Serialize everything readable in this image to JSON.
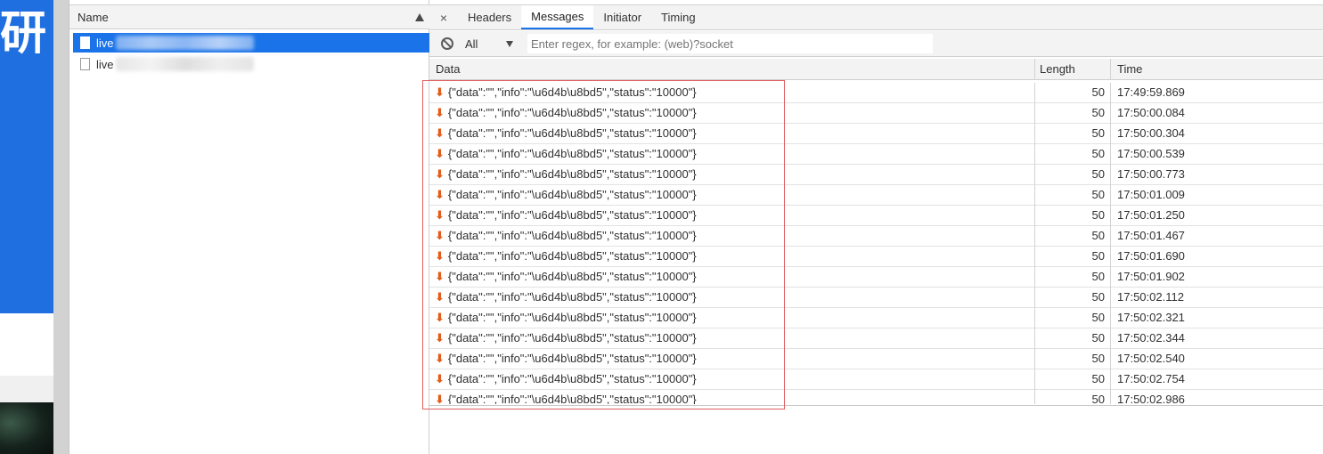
{
  "page": {
    "glyph": "研"
  },
  "name_pane": {
    "header": "Name",
    "items": [
      {
        "label": "live",
        "selected": true
      },
      {
        "label": "live",
        "selected": false
      }
    ]
  },
  "details": {
    "close_icon": "×",
    "tabs": [
      "Headers",
      "Messages",
      "Initiator",
      "Timing"
    ],
    "active_tab": "Messages",
    "filter": {
      "select_value": "All",
      "placeholder": "Enter regex, for example: (web)?socket",
      "value": ""
    },
    "columns": {
      "data": "Data",
      "length": "Length",
      "time": "Time"
    },
    "arrow_glyph": "⬇",
    "messages": [
      {
        "data": "{\"data\":\"\",\"info\":\"\\u6d4b\\u8bd5\",\"status\":\"10000\"}",
        "length": "50",
        "time": "17:49:59.869"
      },
      {
        "data": "{\"data\":\"\",\"info\":\"\\u6d4b\\u8bd5\",\"status\":\"10000\"}",
        "length": "50",
        "time": "17:50:00.084"
      },
      {
        "data": "{\"data\":\"\",\"info\":\"\\u6d4b\\u8bd5\",\"status\":\"10000\"}",
        "length": "50",
        "time": "17:50:00.304"
      },
      {
        "data": "{\"data\":\"\",\"info\":\"\\u6d4b\\u8bd5\",\"status\":\"10000\"}",
        "length": "50",
        "time": "17:50:00.539"
      },
      {
        "data": "{\"data\":\"\",\"info\":\"\\u6d4b\\u8bd5\",\"status\":\"10000\"}",
        "length": "50",
        "time": "17:50:00.773"
      },
      {
        "data": "{\"data\":\"\",\"info\":\"\\u6d4b\\u8bd5\",\"status\":\"10000\"}",
        "length": "50",
        "time": "17:50:01.009"
      },
      {
        "data": "{\"data\":\"\",\"info\":\"\\u6d4b\\u8bd5\",\"status\":\"10000\"}",
        "length": "50",
        "time": "17:50:01.250"
      },
      {
        "data": "{\"data\":\"\",\"info\":\"\\u6d4b\\u8bd5\",\"status\":\"10000\"}",
        "length": "50",
        "time": "17:50:01.467"
      },
      {
        "data": "{\"data\":\"\",\"info\":\"\\u6d4b\\u8bd5\",\"status\":\"10000\"}",
        "length": "50",
        "time": "17:50:01.690"
      },
      {
        "data": "{\"data\":\"\",\"info\":\"\\u6d4b\\u8bd5\",\"status\":\"10000\"}",
        "length": "50",
        "time": "17:50:01.902"
      },
      {
        "data": "{\"data\":\"\",\"info\":\"\\u6d4b\\u8bd5\",\"status\":\"10000\"}",
        "length": "50",
        "time": "17:50:02.112"
      },
      {
        "data": "{\"data\":\"\",\"info\":\"\\u6d4b\\u8bd5\",\"status\":\"10000\"}",
        "length": "50",
        "time": "17:50:02.321"
      },
      {
        "data": "{\"data\":\"\",\"info\":\"\\u6d4b\\u8bd5\",\"status\":\"10000\"}",
        "length": "50",
        "time": "17:50:02.344"
      },
      {
        "data": "{\"data\":\"\",\"info\":\"\\u6d4b\\u8bd5\",\"status\":\"10000\"}",
        "length": "50",
        "time": "17:50:02.540"
      },
      {
        "data": "{\"data\":\"\",\"info\":\"\\u6d4b\\u8bd5\",\"status\":\"10000\"}",
        "length": "50",
        "time": "17:50:02.754"
      },
      {
        "data": "{\"data\":\"\",\"info\":\"\\u6d4b\\u8bd5\",\"status\":\"10000\"}",
        "length": "50",
        "time": "17:50:02.986"
      }
    ]
  },
  "colors": {
    "selection": "#1a73e8",
    "page_blue": "#1f6fe0",
    "arrow": "#e25d19",
    "highlight_box": "#e06060"
  }
}
